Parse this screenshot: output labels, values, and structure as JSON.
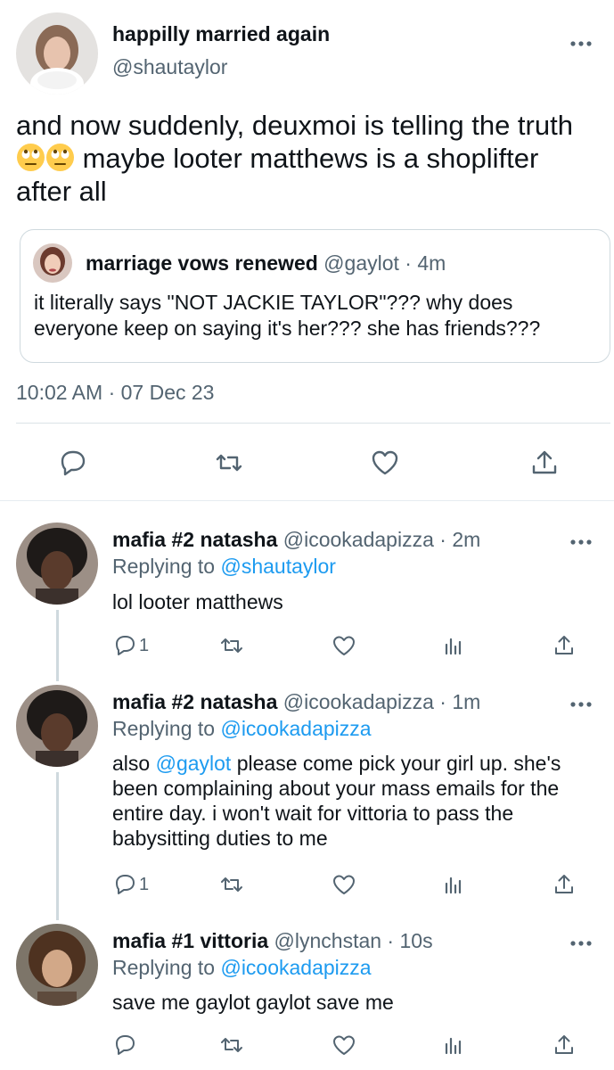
{
  "colors": {
    "accent": "#1d9bf0",
    "text": "#0f1419",
    "muted": "#536471",
    "border": "#cfd9de"
  },
  "main_tweet": {
    "display_name": "happilly married again",
    "handle": "@shautaylor",
    "text_line1": "and now suddenly, deuxmoi is telling the truth",
    "text_line2": " maybe looter matthews is a shoplifter",
    "text_line3": "after all",
    "emoji": "face-with-rolling-eyes-icon",
    "timestamp": "10:02 AM · 07 Dec 23",
    "quoted": {
      "display_name": "marriage vows renewed",
      "meta": " @gaylot · 4m",
      "text": "it literally says \"NOT JACKIE TAYLOR\"??? why does everyone keep on saying it's her??? she has friends???"
    },
    "actions": [
      "reply-icon",
      "retweet-icon",
      "like-icon",
      "share-icon"
    ]
  },
  "replies": [
    {
      "display_name": "mafia #2 natasha",
      "meta": " @icookadapizza · 2m",
      "replying_prefix": "Replying to ",
      "replying_to": "@shautaylor",
      "text": "lol looter matthews",
      "reply_count": "1"
    },
    {
      "display_name": "mafia #2 natasha",
      "meta": " @icookadapizza · 1m",
      "replying_prefix": "Replying to ",
      "replying_to": "@icookadapizza",
      "text_prefix": "also ",
      "mention": "@gaylot",
      "text_rest": " please come pick your girl up. she's been complaining about your mass emails for the entire day. i won't wait for vittoria to pass the babysitting duties to me",
      "reply_count": "1"
    },
    {
      "display_name": "mafia #1 vittoria",
      "meta": " @lynchstan · 10s",
      "replying_prefix": "Replying to ",
      "replying_to": "@icookadapizza",
      "text": "save me gaylot gaylot save me"
    }
  ]
}
